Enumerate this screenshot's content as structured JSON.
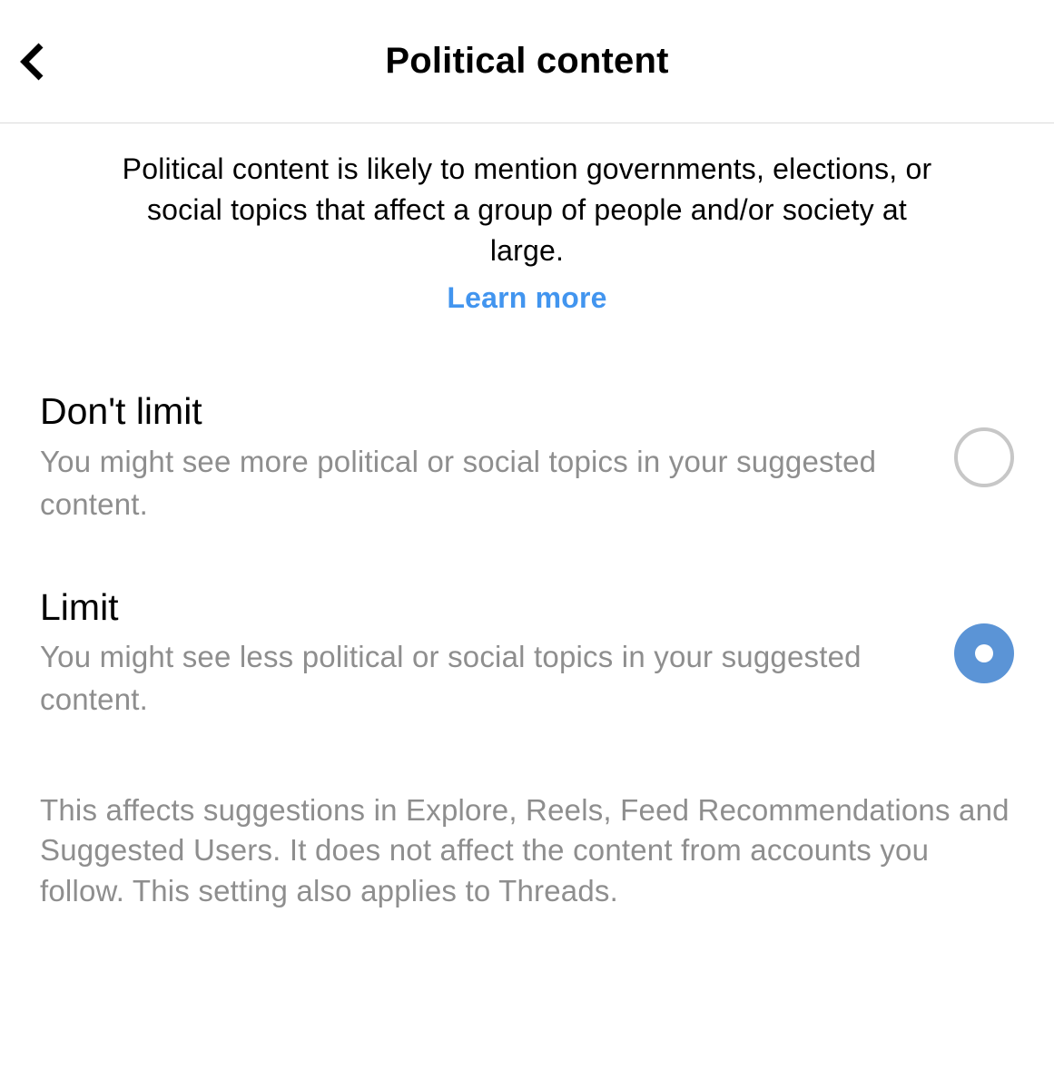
{
  "header": {
    "title": "Political content"
  },
  "intro": {
    "text": "Political content is likely to mention governments, elections, or social topics that affect a group of people and/or society at large.",
    "learn_more_label": "Learn more"
  },
  "options": [
    {
      "title": "Don't limit",
      "desc": "You might see more political or social topics in your suggested content.",
      "selected": false
    },
    {
      "title": "Limit",
      "desc": "You might see less political or social topics in your suggested content.",
      "selected": true
    }
  ],
  "footer_note": "This affects suggestions in Explore, Reels, Feed Recommendations and Suggested Users. It does not affect the content from accounts you follow. This setting also applies to Threads."
}
